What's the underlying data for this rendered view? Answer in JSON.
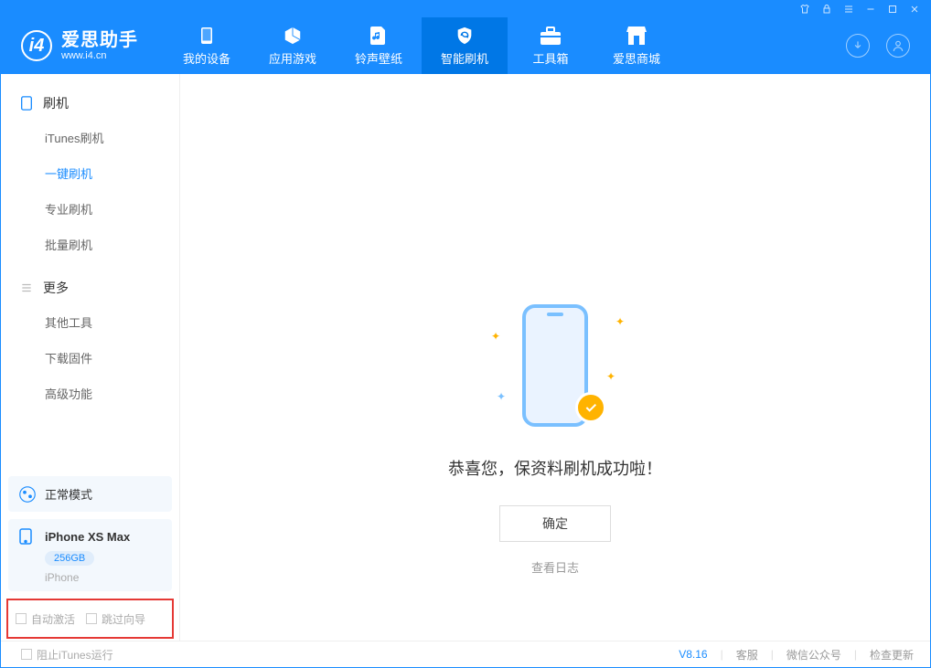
{
  "app": {
    "name_cn": "爱思助手",
    "name_en": "www.i4.cn"
  },
  "tabs": [
    {
      "label": "我的设备"
    },
    {
      "label": "应用游戏"
    },
    {
      "label": "铃声壁纸"
    },
    {
      "label": "智能刷机"
    },
    {
      "label": "工具箱"
    },
    {
      "label": "爱思商城"
    }
  ],
  "sidebar": {
    "group1": {
      "title": "刷机",
      "items": [
        "iTunes刷机",
        "一键刷机",
        "专业刷机",
        "批量刷机"
      ]
    },
    "group2": {
      "title": "更多",
      "items": [
        "其他工具",
        "下载固件",
        "高级功能"
      ]
    }
  },
  "status": {
    "mode": "正常模式"
  },
  "device": {
    "name": "iPhone XS Max",
    "storage": "256GB",
    "type": "iPhone"
  },
  "options": {
    "auto_activate": "自动激活",
    "skip_guide": "跳过向导"
  },
  "result": {
    "message": "恭喜您，保资料刷机成功啦！",
    "ok": "确定",
    "view_log": "查看日志"
  },
  "footer": {
    "block_itunes": "阻止iTunes运行",
    "version": "V8.16",
    "links": [
      "客服",
      "微信公众号",
      "检查更新"
    ]
  }
}
